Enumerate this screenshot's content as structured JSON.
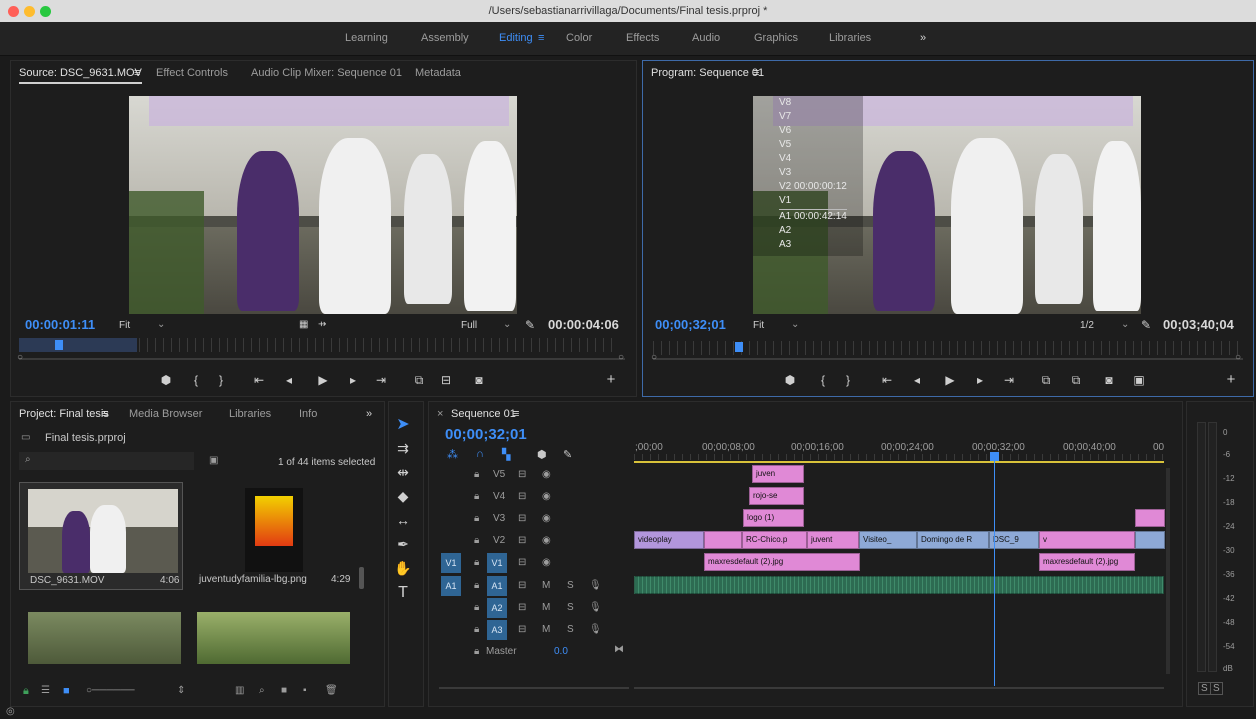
{
  "window": {
    "title": "/Users/sebastianarrivillaga/Documents/Final tesis.prproj *"
  },
  "workspaces": {
    "items": [
      "Learning",
      "Assembly",
      "Editing",
      "Color",
      "Effects",
      "Audio",
      "Graphics",
      "Libraries"
    ],
    "active": "Editing",
    "more": "»"
  },
  "source": {
    "tabs": [
      "Source: DSC_9631.MOV",
      "Effect Controls",
      "Audio Clip Mixer: Sequence 01",
      "Metadata"
    ],
    "timecode": "00:00:01:11",
    "fit": "Fit",
    "quality": "Full",
    "duration": "00:00:04:06"
  },
  "program": {
    "tab": "Program: Sequence 01",
    "timecode": "00;00;32;01",
    "fit": "Fit",
    "quality": "1/2",
    "duration": "00;03;40;04",
    "overlay": [
      "V8",
      "V7",
      "V6",
      "V5",
      "V4",
      "V3",
      "V2  00:00:00:12",
      "V1",
      "A1  00:00:42:14",
      "A2",
      "A3"
    ]
  },
  "project": {
    "tabs": [
      "Project: Final tesis",
      "Media Browser",
      "Libraries",
      "Info"
    ],
    "file": "Final tesis.prproj",
    "count": "1 of 44 items selected",
    "items": [
      {
        "name": "DSC_9631.MOV",
        "dur": "4:06"
      },
      {
        "name": "juventudyfamilia-lbg.png",
        "dur": "4:29"
      }
    ]
  },
  "timeline": {
    "tab": "Sequence 01",
    "timecode": "00;00;32;01",
    "ruler": [
      ";00;00",
      "00;00;08;00",
      "00;00;16;00",
      "00;00;24;00",
      "00;00;32;00",
      "00;00;40;00",
      "00"
    ],
    "tracks": [
      {
        "id": "V5",
        "m": "",
        "s": ""
      },
      {
        "id": "V4",
        "m": "",
        "s": ""
      },
      {
        "id": "V3",
        "m": "",
        "s": ""
      },
      {
        "id": "V2",
        "m": "",
        "s": ""
      },
      {
        "id": "V1",
        "m": "",
        "s": ""
      },
      {
        "id": "A1",
        "m": "M",
        "s": "S"
      },
      {
        "id": "A2",
        "m": "M",
        "s": "S"
      },
      {
        "id": "A3",
        "m": "M",
        "s": "S"
      }
    ],
    "src_v": "V1",
    "src_a": "A1",
    "master": "Master",
    "master_val": "0.0",
    "clips": {
      "juven": "juven",
      "rojo": "rojo-se",
      "logo": "logo (1)",
      "videoplay": "videoplay",
      "rcchico": "RC-Chico.p",
      "juvent": "juvent",
      "visiteo": "Visiteo_",
      "domingo": "Domingo de R",
      "dsc": "DSC_9",
      "v": "v",
      "maxres1": "maxresdefault (2).jpg",
      "maxres2": "maxresdefault (2).jpg"
    }
  },
  "meter": {
    "labels": [
      "0",
      "-6",
      "-12",
      "-18",
      "-24",
      "-30",
      "-36",
      "-42",
      "-48",
      "-54",
      "dB"
    ],
    "solo": [
      "S",
      "S"
    ]
  }
}
